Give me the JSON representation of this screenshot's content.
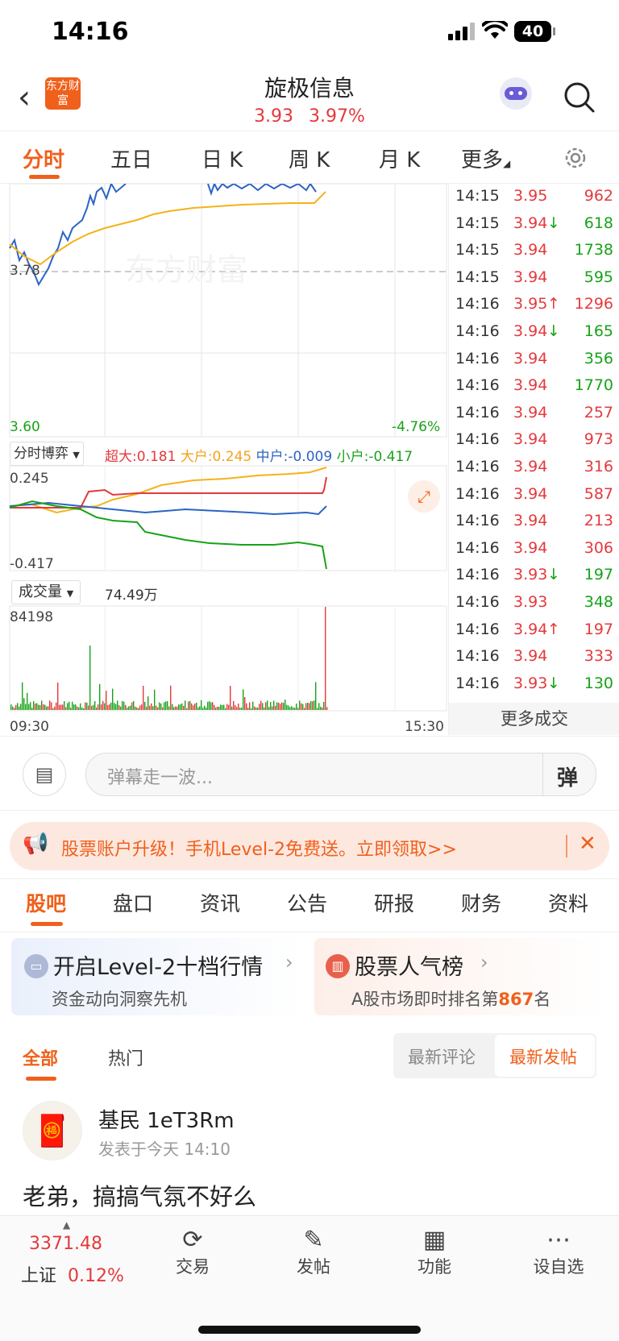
{
  "status_bar": {
    "time": "14:16",
    "battery": "40"
  },
  "header": {
    "title": "旋极信息",
    "price": "3.93",
    "change_pct": "3.97%",
    "brand_logo_text": "东方财富"
  },
  "ktabs": [
    {
      "label": "分时",
      "active": true
    },
    {
      "label": "五日"
    },
    {
      "label": "日 K"
    },
    {
      "label": "周 K"
    },
    {
      "label": "月 K"
    },
    {
      "label": "更多"
    }
  ],
  "main_chart": {
    "base_label": "3.78",
    "low_label": "3.60",
    "low_pct": "-4.76%",
    "watermark": "东方财富"
  },
  "game_panel": {
    "selector": "分时博弈",
    "super_label": "超大:",
    "super_value": "0.181",
    "large_label": "大户:",
    "large_value": "0.245",
    "mid_label": "中户:",
    "mid_value": "-0.009",
    "small_label": "小户:",
    "small_value": "-0.417",
    "top_value": "0.245",
    "bottom_value": "-0.417"
  },
  "volume_panel": {
    "selector": "成交量",
    "total": "74.49",
    "total_unit": "万",
    "max_value": "84198",
    "start_time": "09:30",
    "end_time": "15:30"
  },
  "trades": [
    {
      "time": "14:15",
      "price": "3.95",
      "dir": "",
      "vol": "962",
      "vcolor": "red"
    },
    {
      "time": "14:15",
      "price": "3.94",
      "dir": "↓",
      "vol": "618",
      "vcolor": "green"
    },
    {
      "time": "14:15",
      "price": "3.94",
      "dir": "",
      "vol": "1738",
      "vcolor": "green"
    },
    {
      "time": "14:15",
      "price": "3.94",
      "dir": "",
      "vol": "595",
      "vcolor": "green"
    },
    {
      "time": "14:16",
      "price": "3.95",
      "dir": "↑",
      "vol": "1296",
      "vcolor": "red"
    },
    {
      "time": "14:16",
      "price": "3.94",
      "dir": "↓",
      "vol": "165",
      "vcolor": "green"
    },
    {
      "time": "14:16",
      "price": "3.94",
      "dir": "",
      "vol": "356",
      "vcolor": "green"
    },
    {
      "time": "14:16",
      "price": "3.94",
      "dir": "",
      "vol": "1770",
      "vcolor": "green"
    },
    {
      "time": "14:16",
      "price": "3.94",
      "dir": "",
      "vol": "257",
      "vcolor": "red"
    },
    {
      "time": "14:16",
      "price": "3.94",
      "dir": "",
      "vol": "973",
      "vcolor": "red"
    },
    {
      "time": "14:16",
      "price": "3.94",
      "dir": "",
      "vol": "316",
      "vcolor": "red"
    },
    {
      "time": "14:16",
      "price": "3.94",
      "dir": "",
      "vol": "587",
      "vcolor": "red"
    },
    {
      "time": "14:16",
      "price": "3.94",
      "dir": "",
      "vol": "213",
      "vcolor": "red"
    },
    {
      "time": "14:16",
      "price": "3.94",
      "dir": "",
      "vol": "306",
      "vcolor": "red"
    },
    {
      "time": "14:16",
      "price": "3.93",
      "dir": "↓",
      "vol": "197",
      "vcolor": "green"
    },
    {
      "time": "14:16",
      "price": "3.93",
      "dir": "",
      "vol": "348",
      "vcolor": "green"
    },
    {
      "time": "14:16",
      "price": "3.94",
      "dir": "↑",
      "vol": "197",
      "vcolor": "red"
    },
    {
      "time": "14:16",
      "price": "3.94",
      "dir": "",
      "vol": "333",
      "vcolor": "red"
    },
    {
      "time": "14:16",
      "price": "3.93",
      "dir": "↓",
      "vol": "130",
      "vcolor": "green"
    }
  ],
  "more_trades": "更多成交",
  "danmaku": {
    "placeholder": "弹幕走一波...",
    "button": "弹"
  },
  "banner": {
    "text": "股票账户升级！手机Level-2免费送。立即领取>>"
  },
  "section_tabs": [
    "股吧",
    "盘口",
    "资讯",
    "公告",
    "研报",
    "财务",
    "资料"
  ],
  "cards": [
    {
      "title": "开启Level-2十档行情",
      "sub": "资金动向洞察先机"
    },
    {
      "title": "股票人气榜",
      "sub_prefix": "A股市场即时排名第",
      "rank": "867",
      "sub_suffix": "名"
    }
  ],
  "filter": {
    "all": "全部",
    "hot": "热门",
    "latest_comment": "最新评论",
    "latest_post": "最新发帖"
  },
  "post": {
    "user": "基民 1eT3Rm",
    "meta": "发表于今天 14:10",
    "content": "老弟，搞搞气氛不好么"
  },
  "bottom_nav": {
    "index_value": "3371.48",
    "index_name": "上证",
    "index_pct": "0.12%",
    "items": [
      "交易",
      "发帖",
      "功能",
      "设自选"
    ]
  },
  "colors": {
    "accent": "#f0601b",
    "up": "#e4393c",
    "down": "#18a218",
    "price_line": "#2c64c4",
    "avg_line": "#f5b21a"
  }
}
